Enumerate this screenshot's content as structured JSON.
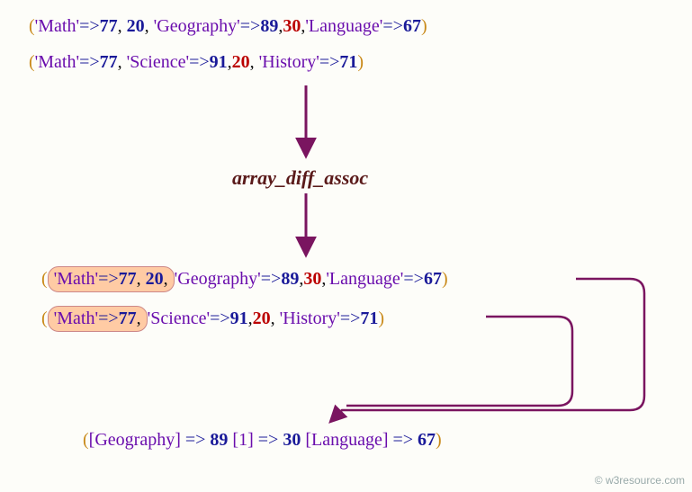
{
  "input1": {
    "open": "(",
    "k1": "'Math'",
    "op1": "=>",
    "v1": "77",
    "c1": ", ",
    "v2": "20",
    "c2": ", ",
    "k3": "'Geography'",
    "op3": "=>",
    "v3": "89",
    "c3": ",",
    "v4": "30",
    "c4": ",",
    "k5": "'Language'",
    "op5": "=>",
    "v5": "67",
    "close": ")"
  },
  "input2": {
    "open": "(",
    "k1": "'Math'",
    "op1": "=>",
    "v1": "77",
    "c1": ", ",
    "k2": "'Science'",
    "op2": "=>",
    "v2": "91",
    "c2": ",",
    "v3": "20",
    "c3": ", ",
    "k4": "'History'",
    "op4": "=>",
    "v4": "71",
    "close": ")"
  },
  "func": "array_diff_assoc",
  "step1": {
    "open": "(",
    "hl": {
      "k1": "'Math'",
      "op1": "=>",
      "v1": "77",
      "c1": ", ",
      "v2": "20",
      "c2": ","
    },
    "k3": "'Geography'",
    "op3": "=>",
    "v3": "89",
    "c3": ",",
    "v4": "30",
    "c4": ",",
    "k5": "'Language'",
    "op5": "=>",
    "v5": "67",
    "close": ")"
  },
  "step2": {
    "open": "(",
    "hl": {
      "k1": "'Math'",
      "op1": "=>",
      "v1": "77",
      "c1": ","
    },
    "k2": "'Science'",
    "op2": "=>",
    "v2": "91",
    "c2": ",",
    "v3": "20",
    "c3": ", ",
    "k4": "'History'",
    "op4": "=>",
    "v4": "71",
    "close": ")"
  },
  "result": {
    "open": "(",
    "k1": "[Geography]",
    "op1": " => ",
    "v1": "89",
    "sp1": " ",
    "k2": "[1]",
    "op2": " => ",
    "v2": "30",
    "sp2": " ",
    "k3": "[Language]",
    "op3": " => ",
    "v3": "67",
    "close": ")"
  },
  "watermark": "© w3resource.com"
}
